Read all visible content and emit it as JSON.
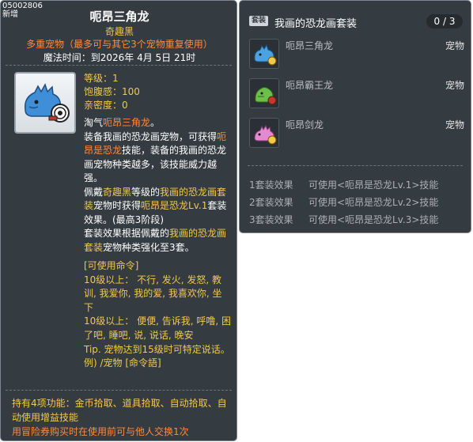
{
  "tooltip": {
    "item_id": "05002806",
    "new_label": "新增",
    "title": "呃昂三角龙",
    "quality": "奇趣黑",
    "multi_pet": "多重宠物（最多可与其它3个宠物重复使用）",
    "expire": "魔法时间：到2026年 4月 5日 21时",
    "stats": {
      "level": "等级：1",
      "fullness": "饱腹感：100",
      "closeness": "亲密度：0"
    },
    "desc": {
      "l1a": "淘气",
      "l1b": "呃昂三角龙",
      "l1c": "。",
      "l2a": "装备我画的恐龙画宠物，可获得",
      "l2b": "呃昂是恐龙",
      "l2c": "技能，装备的我画的恐龙画宠物种类越多，该技能威力越强。",
      "l3a": "佩戴",
      "l3b": "奇趣黑",
      "l3c": "等级的",
      "l3d": "我画的恐龙画套装",
      "l3e": "宠物时获得",
      "l3f": "呃昂是恐龙Lv.1",
      "l3g": "套装效果。(最高3阶段)",
      "l4a": "套装效果根据佩戴的",
      "l4b": "我画的恐龙画套装",
      "l4c": "宠物种类强化至3套。"
    },
    "commands": "[可使用命令]\n10级以上： 不行, 发火, 发怒, 教训, 我爱你, 我的爱, 我喜欢你, 坐下\n10级以上： 便便, 告诉我, 呼噜, 困了吧, 睡吧, 说, 说话, 晚安\nTip. 宠物达到15级时可特定说话。\n例) /宠物 [命令語]",
    "features": "持有4项功能：金币拾取、道具拾取、自动拾取、自动使用增益技能",
    "warning": "用冒险券购买时在使用前可与他人交换1次"
  },
  "set_panel": {
    "tag": "套装",
    "name": "我画的恐龙画套装",
    "count": "0 / 3",
    "items": [
      {
        "name": "呃昂三角龙",
        "type": "宠物",
        "color": "#4aa3e0"
      },
      {
        "name": "呃昂霸王龙",
        "type": "宠物",
        "color": "#6cc04a"
      },
      {
        "name": "呃昂剑龙",
        "type": "宠物",
        "color": "#e48ad0"
      }
    ],
    "effects": [
      {
        "key": "1套装效果",
        "value": "可使用<呃昂是恐龙Lv.1>技能"
      },
      {
        "key": "2套装效果",
        "value": "可使用<呃昂是恐龙Lv.2>技能"
      },
      {
        "key": "3套装效果",
        "value": "可使用<呃昂是恐龙Lv.3>技能"
      }
    ]
  }
}
